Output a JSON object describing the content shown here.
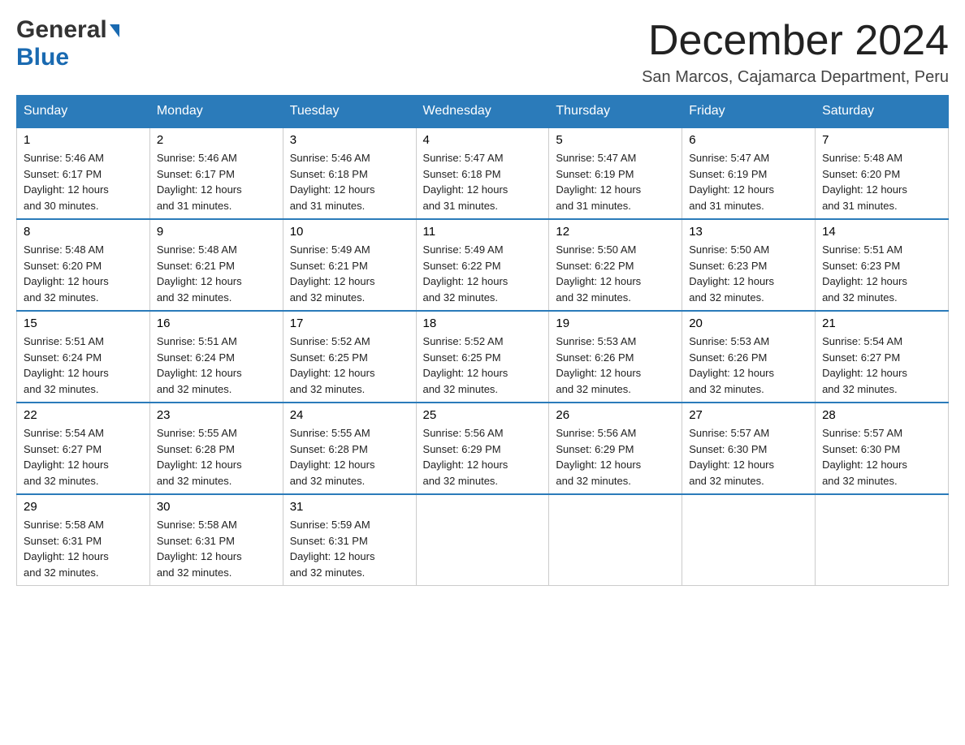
{
  "header": {
    "logo_general": "General",
    "logo_blue": "Blue",
    "month_title": "December 2024",
    "location": "San Marcos, Cajamarca Department, Peru"
  },
  "days_of_week": [
    "Sunday",
    "Monday",
    "Tuesday",
    "Wednesday",
    "Thursday",
    "Friday",
    "Saturday"
  ],
  "weeks": [
    [
      {
        "day": "1",
        "sunrise": "5:46 AM",
        "sunset": "6:17 PM",
        "daylight": "12 hours and 30 minutes."
      },
      {
        "day": "2",
        "sunrise": "5:46 AM",
        "sunset": "6:17 PM",
        "daylight": "12 hours and 31 minutes."
      },
      {
        "day": "3",
        "sunrise": "5:46 AM",
        "sunset": "6:18 PM",
        "daylight": "12 hours and 31 minutes."
      },
      {
        "day": "4",
        "sunrise": "5:47 AM",
        "sunset": "6:18 PM",
        "daylight": "12 hours and 31 minutes."
      },
      {
        "day": "5",
        "sunrise": "5:47 AM",
        "sunset": "6:19 PM",
        "daylight": "12 hours and 31 minutes."
      },
      {
        "day": "6",
        "sunrise": "5:47 AM",
        "sunset": "6:19 PM",
        "daylight": "12 hours and 31 minutes."
      },
      {
        "day": "7",
        "sunrise": "5:48 AM",
        "sunset": "6:20 PM",
        "daylight": "12 hours and 31 minutes."
      }
    ],
    [
      {
        "day": "8",
        "sunrise": "5:48 AM",
        "sunset": "6:20 PM",
        "daylight": "12 hours and 32 minutes."
      },
      {
        "day": "9",
        "sunrise": "5:48 AM",
        "sunset": "6:21 PM",
        "daylight": "12 hours and 32 minutes."
      },
      {
        "day": "10",
        "sunrise": "5:49 AM",
        "sunset": "6:21 PM",
        "daylight": "12 hours and 32 minutes."
      },
      {
        "day": "11",
        "sunrise": "5:49 AM",
        "sunset": "6:22 PM",
        "daylight": "12 hours and 32 minutes."
      },
      {
        "day": "12",
        "sunrise": "5:50 AM",
        "sunset": "6:22 PM",
        "daylight": "12 hours and 32 minutes."
      },
      {
        "day": "13",
        "sunrise": "5:50 AM",
        "sunset": "6:23 PM",
        "daylight": "12 hours and 32 minutes."
      },
      {
        "day": "14",
        "sunrise": "5:51 AM",
        "sunset": "6:23 PM",
        "daylight": "12 hours and 32 minutes."
      }
    ],
    [
      {
        "day": "15",
        "sunrise": "5:51 AM",
        "sunset": "6:24 PM",
        "daylight": "12 hours and 32 minutes."
      },
      {
        "day": "16",
        "sunrise": "5:51 AM",
        "sunset": "6:24 PM",
        "daylight": "12 hours and 32 minutes."
      },
      {
        "day": "17",
        "sunrise": "5:52 AM",
        "sunset": "6:25 PM",
        "daylight": "12 hours and 32 minutes."
      },
      {
        "day": "18",
        "sunrise": "5:52 AM",
        "sunset": "6:25 PM",
        "daylight": "12 hours and 32 minutes."
      },
      {
        "day": "19",
        "sunrise": "5:53 AM",
        "sunset": "6:26 PM",
        "daylight": "12 hours and 32 minutes."
      },
      {
        "day": "20",
        "sunrise": "5:53 AM",
        "sunset": "6:26 PM",
        "daylight": "12 hours and 32 minutes."
      },
      {
        "day": "21",
        "sunrise": "5:54 AM",
        "sunset": "6:27 PM",
        "daylight": "12 hours and 32 minutes."
      }
    ],
    [
      {
        "day": "22",
        "sunrise": "5:54 AM",
        "sunset": "6:27 PM",
        "daylight": "12 hours and 32 minutes."
      },
      {
        "day": "23",
        "sunrise": "5:55 AM",
        "sunset": "6:28 PM",
        "daylight": "12 hours and 32 minutes."
      },
      {
        "day": "24",
        "sunrise": "5:55 AM",
        "sunset": "6:28 PM",
        "daylight": "12 hours and 32 minutes."
      },
      {
        "day": "25",
        "sunrise": "5:56 AM",
        "sunset": "6:29 PM",
        "daylight": "12 hours and 32 minutes."
      },
      {
        "day": "26",
        "sunrise": "5:56 AM",
        "sunset": "6:29 PM",
        "daylight": "12 hours and 32 minutes."
      },
      {
        "day": "27",
        "sunrise": "5:57 AM",
        "sunset": "6:30 PM",
        "daylight": "12 hours and 32 minutes."
      },
      {
        "day": "28",
        "sunrise": "5:57 AM",
        "sunset": "6:30 PM",
        "daylight": "12 hours and 32 minutes."
      }
    ],
    [
      {
        "day": "29",
        "sunrise": "5:58 AM",
        "sunset": "6:31 PM",
        "daylight": "12 hours and 32 minutes."
      },
      {
        "day": "30",
        "sunrise": "5:58 AM",
        "sunset": "6:31 PM",
        "daylight": "12 hours and 32 minutes."
      },
      {
        "day": "31",
        "sunrise": "5:59 AM",
        "sunset": "6:31 PM",
        "daylight": "12 hours and 32 minutes."
      },
      null,
      null,
      null,
      null
    ]
  ],
  "labels": {
    "sunrise": "Sunrise:",
    "sunset": "Sunset:",
    "daylight": "Daylight:"
  }
}
